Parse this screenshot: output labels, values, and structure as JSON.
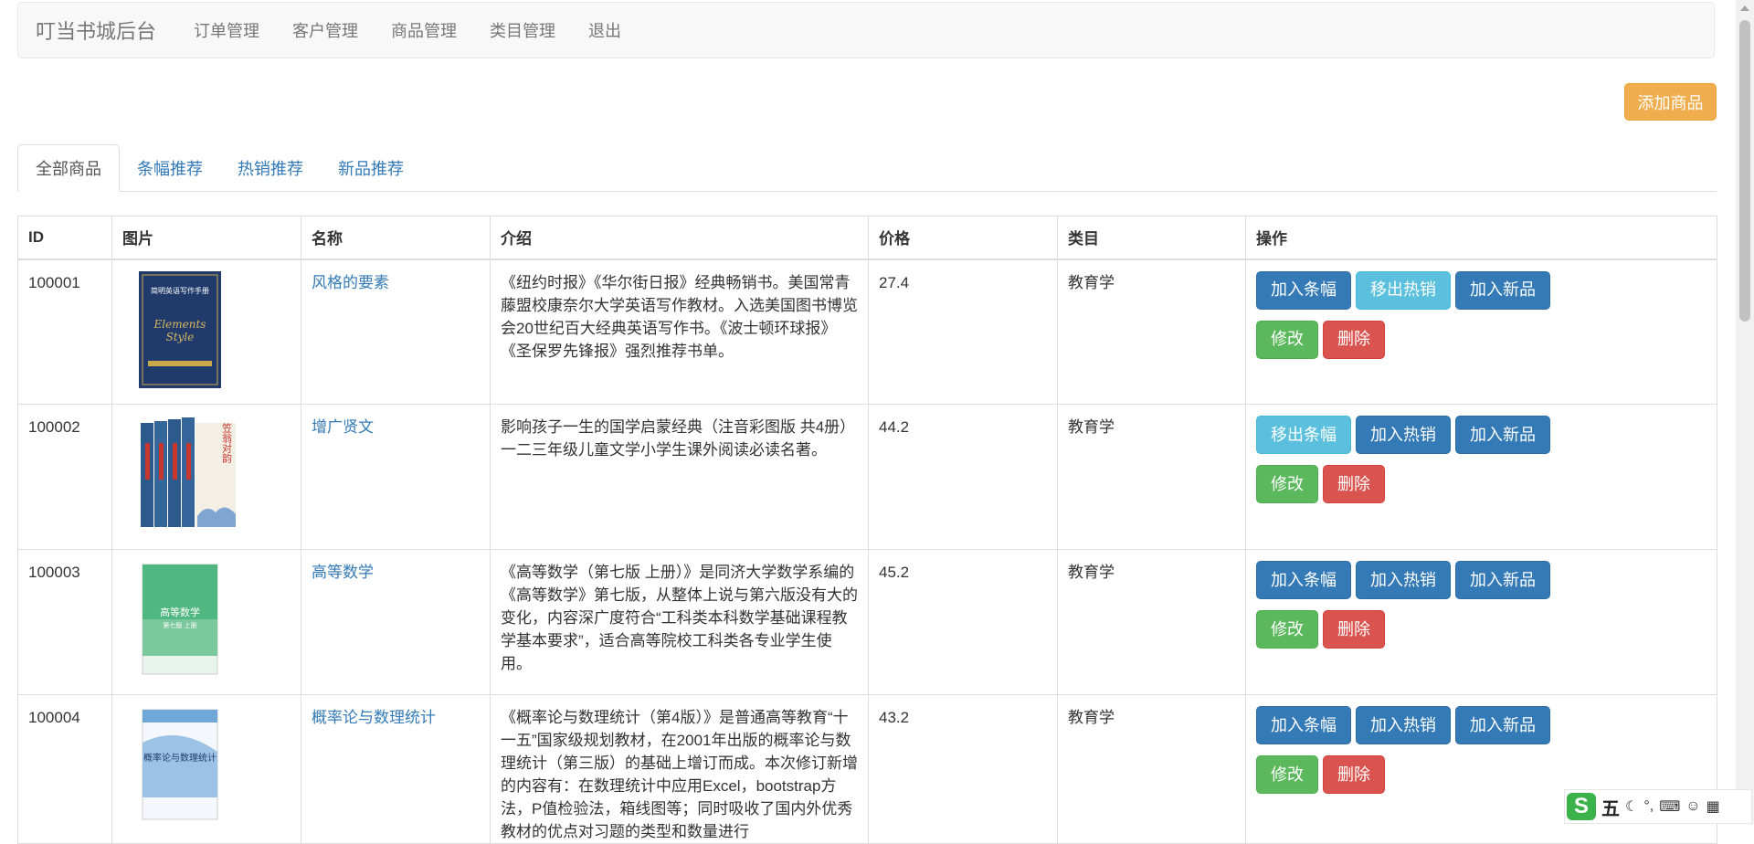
{
  "navbar": {
    "brand": "叮当书城后台",
    "links": [
      "订单管理",
      "客户管理",
      "商品管理",
      "类目管理",
      "退出"
    ]
  },
  "add_button": "添加商品",
  "tabs": [
    "全部商品",
    "条幅推荐",
    "热销推荐",
    "新品推荐"
  ],
  "table": {
    "headers": [
      "ID",
      "图片",
      "名称",
      "介绍",
      "价格",
      "类目",
      "操作"
    ],
    "rows": [
      {
        "id": "100001",
        "name": "风格的要素",
        "desc": "《纽约时报》《华尔街日报》经典畅销书。美国常青藤盟校康奈尔大学英语写作教材。入选美国图书博览会20世纪百大经典英语写作书。《波士顿环球报》《圣保罗先锋报》强烈推荐书单。",
        "price": "27.4",
        "category": "教育学",
        "ops": [
          "加入条幅",
          "移出热销",
          "加入新品",
          "修改",
          "删除"
        ]
      },
      {
        "id": "100002",
        "name": "增广贤文",
        "desc": "影响孩子一生的国学启蒙经典（注音彩图版 共4册）一二三年级儿童文学小学生课外阅读必读名著。",
        "price": "44.2",
        "category": "教育学",
        "ops": [
          "移出条幅",
          "加入热销",
          "加入新品",
          "修改",
          "删除"
        ]
      },
      {
        "id": "100003",
        "name": "高等数学",
        "desc": "《高等数学（第七版 上册）》是同济大学数学系编的《高等数学》第七版，从整体上说与第六版没有大的变化，内容深广度符合“工科类本科数学基础课程教学基本要求”，适合高等院校工科类各专业学生使用。",
        "price": "45.2",
        "category": "教育学",
        "ops": [
          "加入条幅",
          "加入热销",
          "加入新品",
          "修改",
          "删除"
        ]
      },
      {
        "id": "100004",
        "name": "概率论与数理统计",
        "desc": "《概率论与数理统计（第4版）》是普通高等教育“十一五”国家级规划教材，在2001年出版的概率论与数理统计（第三版）的基础上增订而成。本次修订新增的内容有：在数理统计中应用Excel，bootstrap方法，P值检验法，箱线图等；同时吸收了国内外优秀教材的优点对习题的类型和数量进行",
        "price": "43.2",
        "category": "教育学",
        "ops": [
          "加入条幅",
          "加入热销",
          "加入新品",
          "修改",
          "删除"
        ]
      }
    ]
  },
  "covers": [
    {
      "title": "简明英语写作手册",
      "subtitle": "Elements of Style",
      "color": "#1f3a6b"
    },
    {
      "title": "笠翁对韵",
      "color": "#2d5a8c"
    },
    {
      "title": "高等数学",
      "subtitle": "第七版 上册",
      "color": "#3faa6e"
    },
    {
      "title": "概率论与数理统计",
      "color": "#6fa7d6"
    }
  ],
  "ime": {
    "char": "五"
  }
}
